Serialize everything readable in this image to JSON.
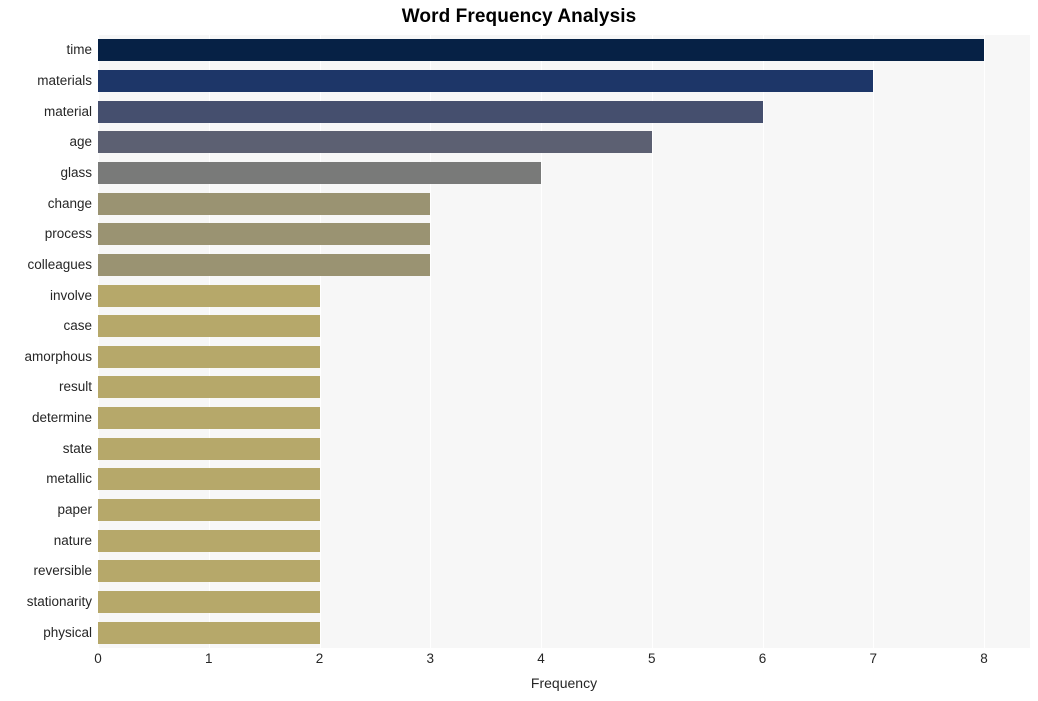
{
  "chart_data": {
    "type": "bar",
    "orientation": "horizontal",
    "title": "Word Frequency Analysis",
    "xlabel": "Frequency",
    "ylabel": "",
    "xlim": [
      0,
      8
    ],
    "xticks": [
      0,
      1,
      2,
      3,
      4,
      5,
      6,
      7,
      8
    ],
    "xtick_labels": [
      "0",
      "1",
      "2",
      "3",
      "4",
      "5",
      "6",
      "7",
      "8"
    ],
    "grid": "vertical-white-on-light-gray",
    "legend": "none",
    "categories": [
      "time",
      "materials",
      "material",
      "age",
      "glass",
      "change",
      "process",
      "colleagues",
      "involve",
      "case",
      "amorphous",
      "result",
      "determine",
      "state",
      "metallic",
      "paper",
      "nature",
      "reversible",
      "stationarity",
      "physical"
    ],
    "values": [
      8,
      7,
      6,
      5,
      4,
      3,
      3,
      3,
      2,
      2,
      2,
      2,
      2,
      2,
      2,
      2,
      2,
      2,
      2,
      2
    ],
    "bar_colors": [
      "#062145",
      "#1d3668",
      "#454f6e",
      "#5c6072",
      "#797a79",
      "#9a9372",
      "#9a9372",
      "#9a9372",
      "#b6a86a",
      "#b6a86a",
      "#b6a86a",
      "#b6a86a",
      "#b6a86a",
      "#b6a86a",
      "#b6a86a",
      "#b6a86a",
      "#b6a86a",
      "#b6a86a",
      "#b6a86a",
      "#b6a86a"
    ],
    "plot_background": "#f7f7f7",
    "grid_color": "#ffffff",
    "text_color": "#262626",
    "title_color": "#000000"
  }
}
